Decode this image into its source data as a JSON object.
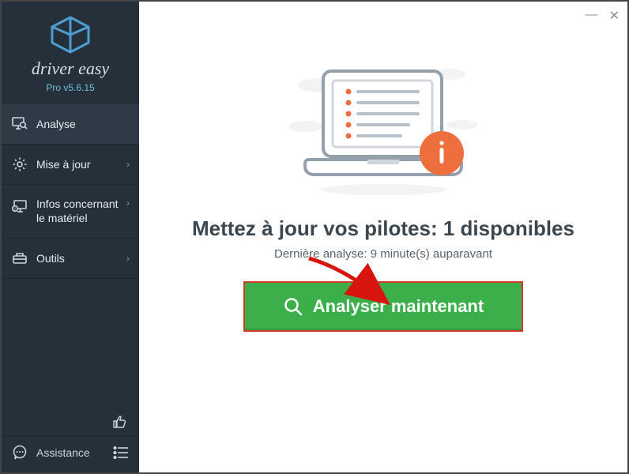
{
  "brand": {
    "name": "driver easy",
    "version": "Pro v5.6.15"
  },
  "nav": {
    "items": [
      {
        "label": "Analyse",
        "expandable": false
      },
      {
        "label": "Mise à jour",
        "expandable": true
      },
      {
        "label": "Infos concernant le matériel",
        "expandable": true
      },
      {
        "label": "Outils",
        "expandable": true
      }
    ]
  },
  "assistance": {
    "label": "Assistance"
  },
  "main": {
    "headline": "Mettez à jour vos pilotes: 1 disponibles",
    "subline": "Dernière analyse: 9 minute(s) auparavant",
    "cta_label": "Analyser maintenant"
  },
  "colors": {
    "sidebar_bg": "#25303a",
    "cta_bg": "#3bb04a",
    "highlight_border": "#d23a2a",
    "info_badge": "#ee6f3e",
    "accent": "#4d9fd1"
  }
}
